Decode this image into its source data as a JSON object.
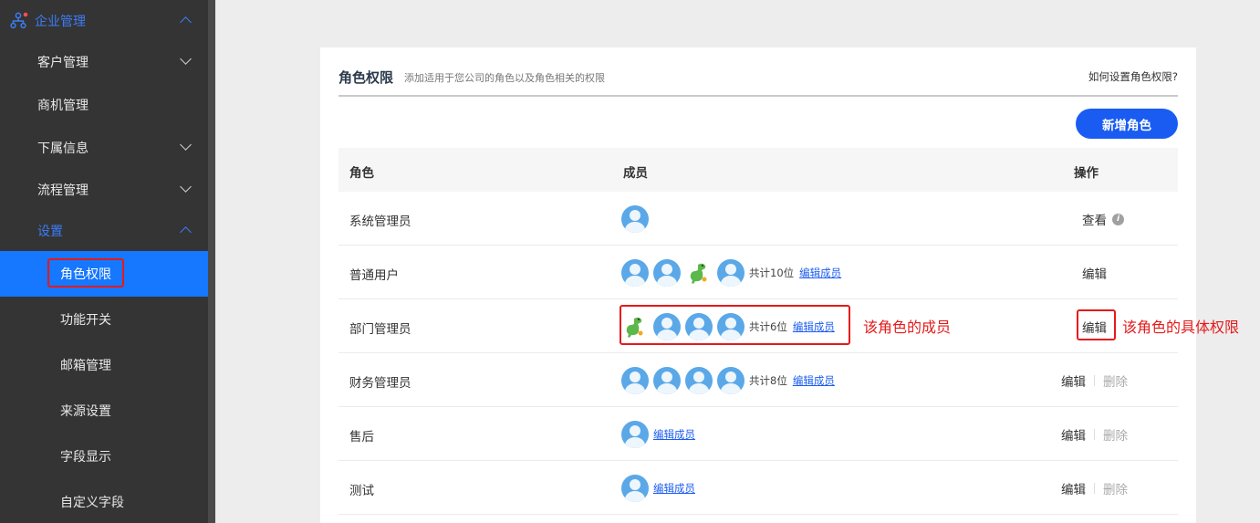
{
  "sidebar": {
    "section_enterprise": "企业管理",
    "items": [
      {
        "label": "客户管理"
      },
      {
        "label": "商机管理"
      },
      {
        "label": "下属信息"
      },
      {
        "label": "流程管理"
      }
    ],
    "section_settings": "设置",
    "sub_items": [
      {
        "label": "角色权限"
      },
      {
        "label": "功能开关"
      },
      {
        "label": "邮箱管理"
      },
      {
        "label": "来源设置"
      },
      {
        "label": "字段显示"
      },
      {
        "label": "自定义字段"
      }
    ]
  },
  "header": {
    "title": "角色权限",
    "subtitle": "添加适用于您公司的角色以及角色相关的权限",
    "help_link": "如何设置角色权限?"
  },
  "toolbar": {
    "new_role_label": "新增角色"
  },
  "table": {
    "columns": [
      "角色",
      "成员",
      "操作"
    ],
    "rows": [
      {
        "role": "系统管理员",
        "count": "",
        "edit_members": "",
        "action": "查看",
        "delete": ""
      },
      {
        "role": "普通用户",
        "count": "共计10位",
        "edit_members": "编辑成员",
        "action": "编辑",
        "delete": ""
      },
      {
        "role": "部门管理员",
        "count": "共计6位",
        "edit_members": "编辑成员",
        "action": "编辑",
        "delete": ""
      },
      {
        "role": "财务管理员",
        "count": "共计8位",
        "edit_members": "编辑成员",
        "action": "编辑",
        "delete": "删除"
      },
      {
        "role": "售后",
        "count": "",
        "edit_members": "编辑成员",
        "action": "编辑",
        "delete": "删除"
      },
      {
        "role": "测试",
        "count": "",
        "edit_members": "编辑成员",
        "action": "编辑",
        "delete": "删除"
      }
    ]
  },
  "annotations": {
    "members_note": "该角色的成员",
    "permissions_note": "该角色的具体权限"
  },
  "colors": {
    "accent": "#1677ff",
    "highlight": "#e51a1a",
    "sidebar_bg": "#343434"
  }
}
